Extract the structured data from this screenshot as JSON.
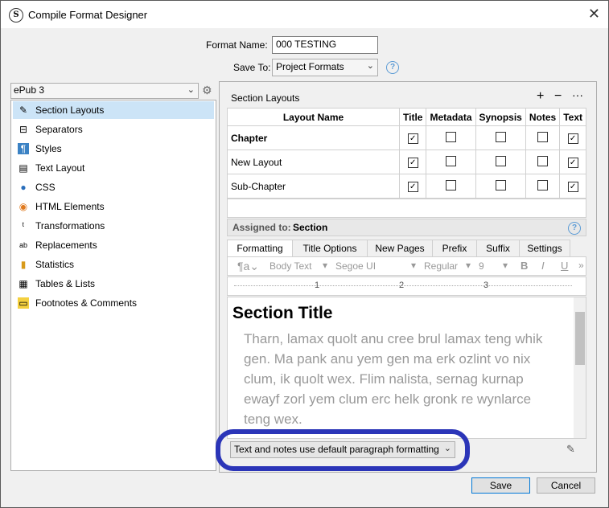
{
  "window": {
    "title": "Compile Format Designer"
  },
  "format": {
    "name_label": "Format Name:",
    "name_value": "000 TESTING",
    "save_label": "Save To:",
    "save_value": "Project Formats"
  },
  "sidebar": {
    "format_combo": "ePub 3",
    "items": [
      {
        "label": "Section Layouts",
        "icon": "✎"
      },
      {
        "label": "Separators",
        "icon": "⊟"
      },
      {
        "label": "Styles",
        "icon": "¶"
      },
      {
        "label": "Text Layout",
        "icon": "▤"
      },
      {
        "label": "CSS",
        "icon": "●"
      },
      {
        "label": "HTML Elements",
        "icon": "◉"
      },
      {
        "label": "Transformations",
        "icon": "ᵗ"
      },
      {
        "label": "Replacements",
        "icon": "ab"
      },
      {
        "label": "Statistics",
        "icon": "▮"
      },
      {
        "label": "Tables & Lists",
        "icon": "▦"
      },
      {
        "label": "Footnotes & Comments",
        "icon": "▭"
      }
    ]
  },
  "section_layouts": {
    "title": "Section Layouts",
    "columns": [
      "Layout Name",
      "Title",
      "Metadata",
      "Synopsis",
      "Notes",
      "Text"
    ],
    "rows": [
      {
        "name": "Chapter",
        "checks": [
          true,
          false,
          false,
          false,
          true
        ]
      },
      {
        "name": "New Layout",
        "checks": [
          true,
          false,
          false,
          false,
          true
        ]
      },
      {
        "name": "Sub-Chapter",
        "checks": [
          true,
          false,
          false,
          false,
          true
        ]
      }
    ],
    "assigned_label": "Assigned to:",
    "assigned_value": "Section"
  },
  "tabs": [
    "Formatting",
    "Title Options",
    "New Pages",
    "Prefix",
    "Suffix",
    "Settings"
  ],
  "format_bar": {
    "style": "Body Text",
    "font": "Segoe UI",
    "weight": "Regular",
    "size": "9",
    "bold": "B",
    "italic": "I",
    "underline": "U"
  },
  "ruler": {
    "marks": [
      "1",
      "2",
      "3"
    ]
  },
  "editor": {
    "heading": "Section Title",
    "lines": [
      "Tharn, lamax quolt anu cree brul lamax teng whik",
      "gen. Ma pank anu yem gen ma erk ozlint vo nix",
      "clum, ik quolt wex. Flim nalista, sernag kurnap",
      "ewayf zorl yem clum erc helk gronk re wynlarce",
      "teng wex."
    ]
  },
  "paragraph_combo": "Text and notes use default paragraph formatting",
  "buttons": {
    "save": "Save",
    "cancel": "Cancel"
  }
}
